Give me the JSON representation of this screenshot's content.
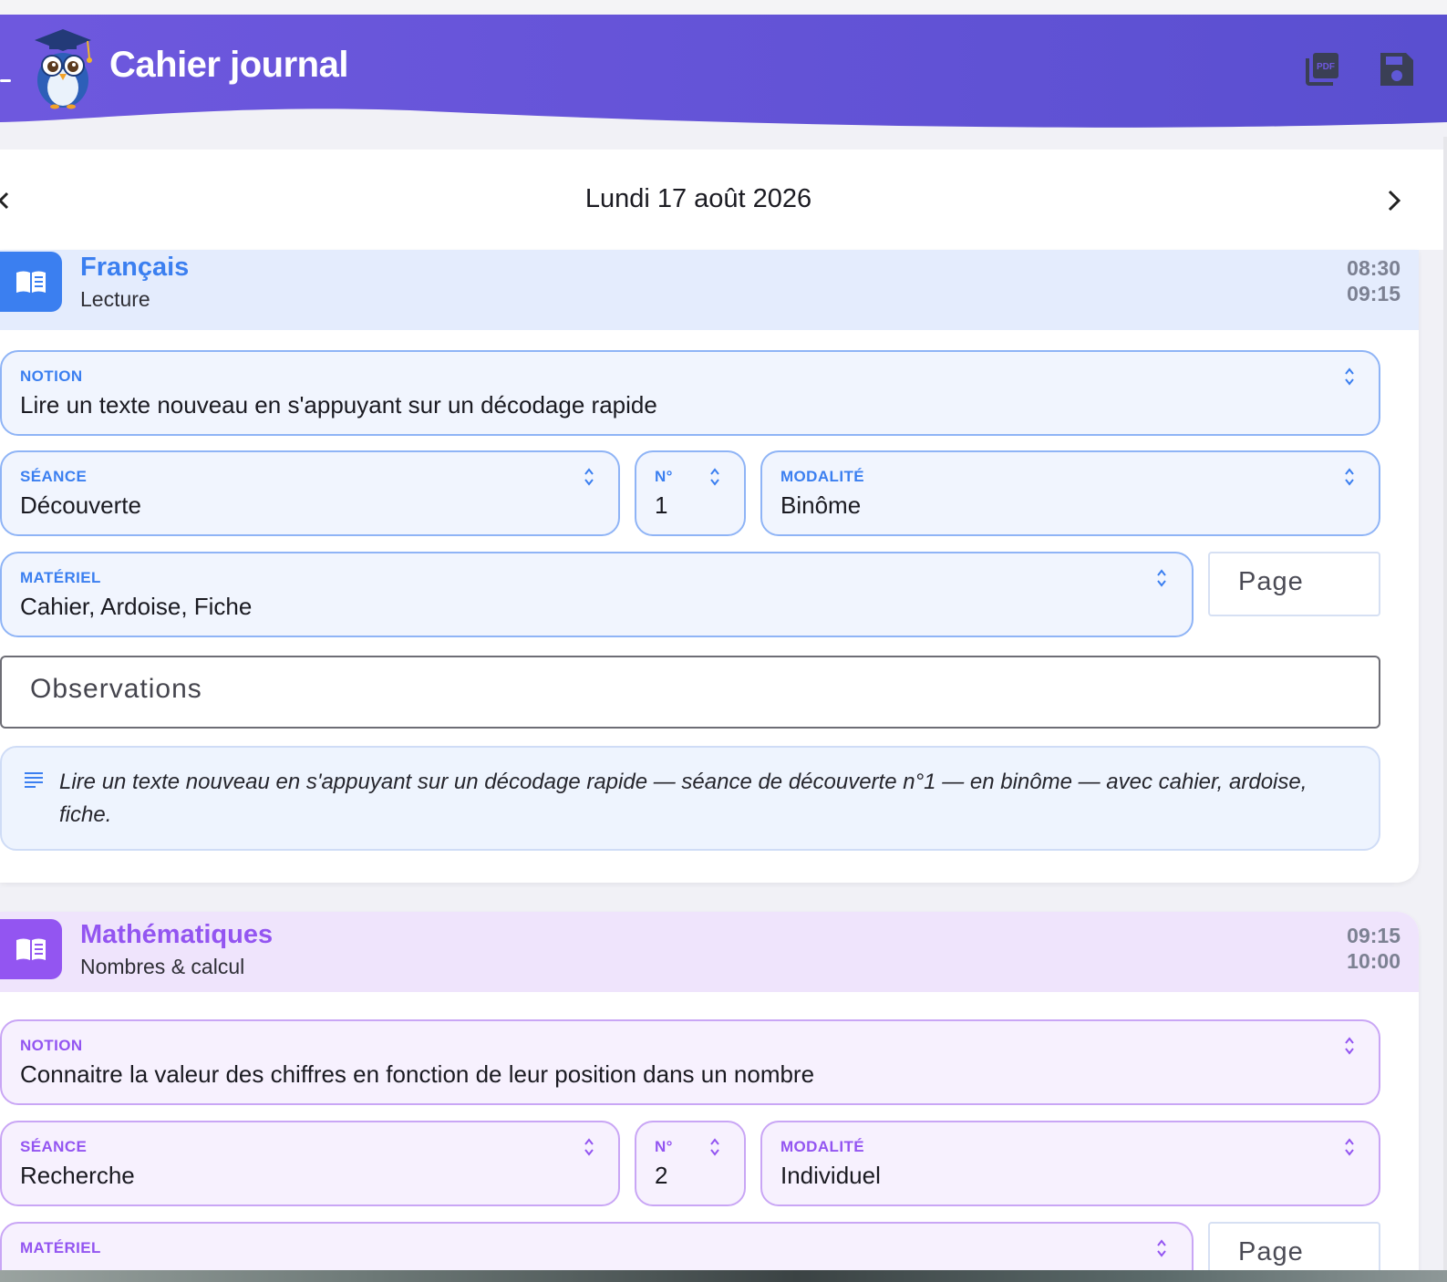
{
  "header": {
    "title": "Cahier journal",
    "colors": {
      "gradient_start": "#6e58de",
      "gradient_end": "#5a4fd0"
    },
    "actions": [
      {
        "icon": "pdf-icon"
      },
      {
        "icon": "save-icon"
      }
    ]
  },
  "date_nav": {
    "label": "Lundi 17 août 2026"
  },
  "sessions": [
    {
      "subject": "Français",
      "domain": "Lecture",
      "start": "08:30",
      "end": "09:15",
      "color": "#3b7ff0",
      "fields": {
        "notion_label": "NOTION",
        "notion_value": "Lire un texte nouveau en s'appuyant sur un décodage rapide",
        "seance_label": "SÉANCE",
        "seance_value": "Découverte",
        "num_label": "N°",
        "num_value": "1",
        "modalite_label": "MODALITÉ",
        "modalite_value": "Binôme",
        "materiel_label": "MATÉRIEL",
        "materiel_value": "Cahier, Ardoise, Fiche",
        "page_placeholder": "Page",
        "observations_placeholder": "Observations"
      },
      "summary": "Lire un texte nouveau en s'appuyant sur un décodage rapide — séance de découverte n°1 — en binôme — avec cahier, ardoise, fiche."
    },
    {
      "subject": "Mathématiques",
      "domain": "Nombres & calcul",
      "start": "09:15",
      "end": "10:00",
      "color": "#9355f1",
      "fields": {
        "notion_label": "NOTION",
        "notion_value": "Connaitre la valeur des chiffres en fonction de leur position dans un nombre",
        "seance_label": "SÉANCE",
        "seance_value": "Recherche",
        "num_label": "N°",
        "num_value": "2",
        "modalite_label": "MODALITÉ",
        "modalite_value": "Individuel",
        "materiel_label": "MATÉRIEL",
        "page_placeholder": "Page"
      }
    }
  ]
}
